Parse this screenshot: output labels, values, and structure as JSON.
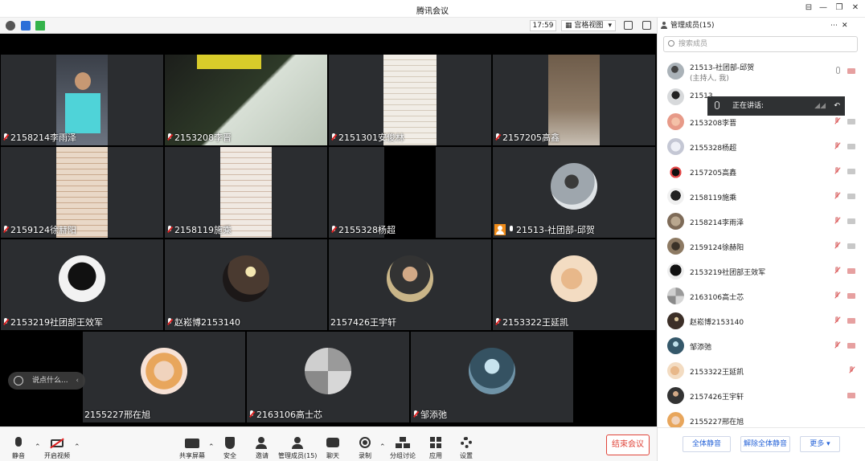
{
  "window": {
    "title": "腾讯会议"
  },
  "infobar": {
    "time": "17:59",
    "view_mode": "宫格视图"
  },
  "tiles": [
    {
      "name": "2158214李雨泽",
      "mic": "off"
    },
    {
      "name": "2153208李晋",
      "mic": "off"
    },
    {
      "name": "2151301安俊林",
      "mic": "off"
    },
    {
      "name": "2157205高鑫",
      "mic": "off"
    },
    {
      "name": "2159124徐赫阳",
      "mic": "off"
    },
    {
      "name": "2158119施乘",
      "mic": "off"
    },
    {
      "name": "2155328杨超",
      "mic": "off"
    },
    {
      "name": "21513-社团部-邱贺",
      "mic": "on",
      "host": true
    },
    {
      "name": "2153219社团部王效军",
      "mic": "off"
    },
    {
      "name": "赵崧博2153140",
      "mic": "off"
    },
    {
      "name": "2157426王宇轩",
      "mic": "none"
    },
    {
      "name": "2153322王延凯",
      "mic": "off"
    },
    {
      "name": "2155227邢在旭",
      "mic": "none"
    },
    {
      "name": "2163106高士芯",
      "mic": "off"
    },
    {
      "name": "邹添弛",
      "mic": "off"
    }
  ],
  "chat": {
    "placeholder": "说点什么..."
  },
  "toolbar": {
    "mute": "静音",
    "video": "开启视频",
    "share": "共享屏幕",
    "security": "安全",
    "invite": "邀请",
    "members": "管理成员(15)",
    "chat": "聊天",
    "record": "录制",
    "breakout": "分组讨论",
    "apps": "应用",
    "settings": "设置",
    "end": "结束会议"
  },
  "panel": {
    "title": "管理成员(15)",
    "search_placeholder": "搜索成员",
    "speaking": "正在讲话:",
    "members": [
      {
        "name": "21513-社团部-邱贺",
        "sub": "(主持人, 我)",
        "cam": "on",
        "mic": "on"
      },
      {
        "name": "21513",
        "cam": "on",
        "mic": "on"
      },
      {
        "name": "2153208李晋",
        "cam": "on",
        "mic": "off"
      },
      {
        "name": "2155328杨超",
        "cam": "on",
        "mic": "off"
      },
      {
        "name": "2157205高鑫",
        "cam": "on",
        "mic": "off"
      },
      {
        "name": "2158119施乘",
        "cam": "on",
        "mic": "off"
      },
      {
        "name": "2158214李雨泽",
        "cam": "on",
        "mic": "off"
      },
      {
        "name": "2159124徐赫阳",
        "cam": "on",
        "mic": "off"
      },
      {
        "name": "2153219社团部王效军",
        "cam": "off",
        "mic": "off"
      },
      {
        "name": "2163106高士芯",
        "cam": "off",
        "mic": "off"
      },
      {
        "name": "赵崧博2153140",
        "cam": "off",
        "mic": "off"
      },
      {
        "name": "邹添弛",
        "cam": "off",
        "mic": "off"
      },
      {
        "name": "2153322王延凯",
        "cam": "none",
        "mic": "off"
      },
      {
        "name": "2157426王宇轩",
        "cam": "off",
        "mic": "none"
      },
      {
        "name": "2155227邢在旭",
        "cam": "none",
        "mic": "none"
      }
    ],
    "mute_all": "全体静音",
    "unmute_all": "解除全体静音",
    "more": "更多"
  }
}
